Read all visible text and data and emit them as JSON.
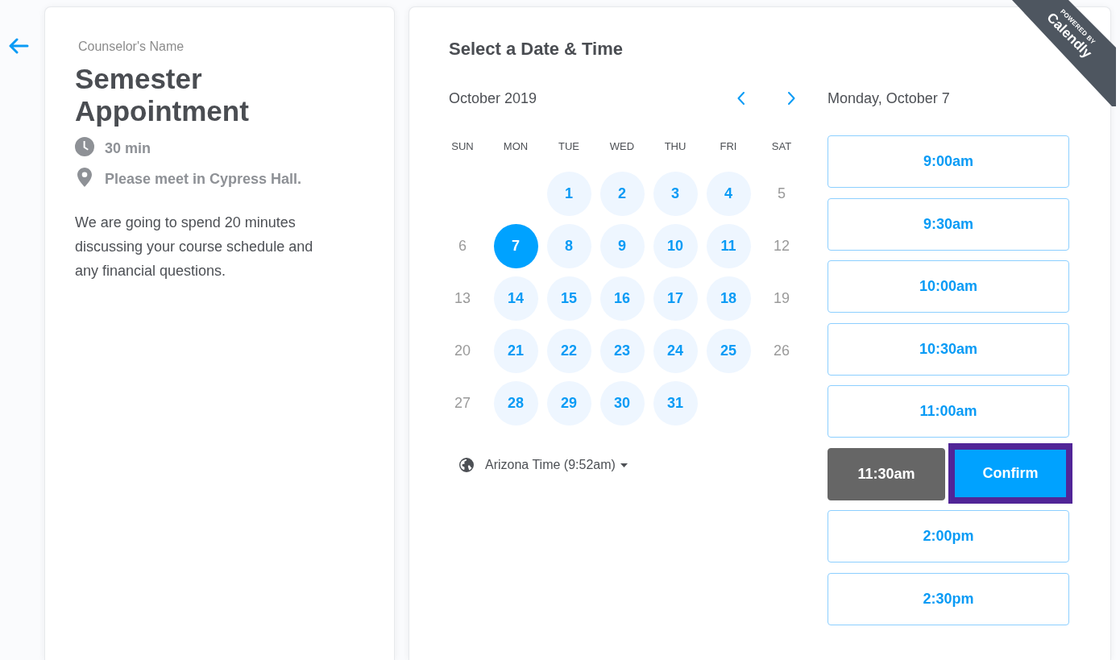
{
  "event": {
    "organizer": "Counselor's Name",
    "title": "Semester Appointment",
    "details": [
      {
        "kind": "duration",
        "text": "30 min"
      },
      {
        "kind": "location",
        "text": "Please meet in Cypress Hall."
      }
    ],
    "description": "We are going to spend 20 minutes discussing your course schedule and any financial questions."
  },
  "scheduler": {
    "heading": "Select a Date & Time",
    "calendar": {
      "month": "October 2019",
      "weekdays": [
        "SUN",
        "MON",
        "TUE",
        "WED",
        "THU",
        "FRI",
        "SAT"
      ],
      "weeks": [
        [
          {
            "label": "1",
            "available": true,
            "selected": false
          },
          {
            "label": "2",
            "available": true,
            "selected": false
          },
          {
            "label": "3",
            "available": true,
            "selected": false
          },
          {
            "label": "4",
            "available": true,
            "selected": false
          },
          {
            "label": "5",
            "available": false,
            "selected": false
          }
        ],
        [
          {
            "label": "6",
            "available": false,
            "selected": false
          },
          {
            "label": "7",
            "available": true,
            "selected": true
          },
          {
            "label": "8",
            "available": true,
            "selected": false
          },
          {
            "label": "9",
            "available": true,
            "selected": false
          },
          {
            "label": "10",
            "available": true,
            "selected": false
          },
          {
            "label": "11",
            "available": true,
            "selected": false
          },
          {
            "label": "12",
            "available": false,
            "selected": false
          }
        ],
        [
          {
            "label": "13",
            "available": false,
            "selected": false
          },
          {
            "label": "14",
            "available": true,
            "selected": false
          },
          {
            "label": "15",
            "available": true,
            "selected": false
          },
          {
            "label": "16",
            "available": true,
            "selected": false
          },
          {
            "label": "17",
            "available": true,
            "selected": false
          },
          {
            "label": "18",
            "available": true,
            "selected": false
          },
          {
            "label": "19",
            "available": false,
            "selected": false
          }
        ],
        [
          {
            "label": "20",
            "available": false,
            "selected": false
          },
          {
            "label": "21",
            "available": true,
            "selected": false
          },
          {
            "label": "22",
            "available": true,
            "selected": false
          },
          {
            "label": "23",
            "available": true,
            "selected": false
          },
          {
            "label": "24",
            "available": true,
            "selected": false
          },
          {
            "label": "25",
            "available": true,
            "selected": false
          },
          {
            "label": "26",
            "available": false,
            "selected": false
          }
        ],
        [
          {
            "label": "27",
            "available": false,
            "selected": false
          },
          {
            "label": "28",
            "available": true,
            "selected": false
          },
          {
            "label": "29",
            "available": true,
            "selected": false
          },
          {
            "label": "30",
            "available": true,
            "selected": false
          },
          {
            "label": "31",
            "available": true,
            "selected": false
          }
        ]
      ]
    },
    "timezone": {
      "label": "Arizona Time (9:52am)"
    },
    "selected_date": "Monday, October 7",
    "slots": [
      {
        "time": "9:00am",
        "selected": false
      },
      {
        "time": "9:30am",
        "selected": false
      },
      {
        "time": "10:00am",
        "selected": false
      },
      {
        "time": "10:30am",
        "selected": false
      },
      {
        "time": "11:00am",
        "selected": false
      },
      {
        "time": "11:30am",
        "selected": true
      },
      {
        "time": "2:00pm",
        "selected": false
      },
      {
        "time": "2:30pm",
        "selected": false
      }
    ],
    "confirm": {
      "label": "Confirm",
      "focused": true
    }
  },
  "ribbon": {
    "caption": "POWERED BY",
    "brand": "Calendly"
  }
}
